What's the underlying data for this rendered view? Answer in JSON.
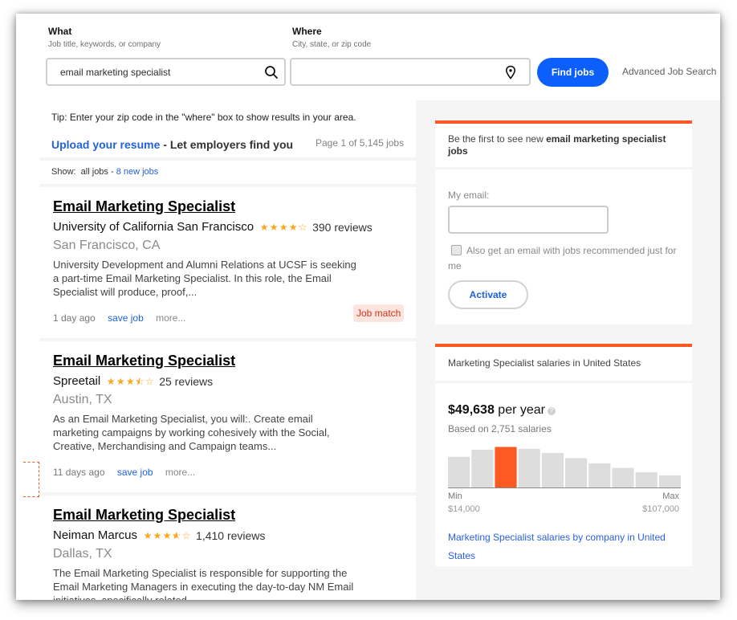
{
  "search": {
    "what_label": "What",
    "what_hint": "Job title, keywords, or company",
    "what_value": "email marketing specialist",
    "where_label": "Where",
    "where_hint": "City, state, or zip code",
    "where_value": "",
    "find_button": "Find jobs",
    "advanced_link": "Advanced Job Search",
    "icons": {
      "what": "search-icon",
      "where": "location-pin-icon"
    }
  },
  "results_header": {
    "tip": "Tip: Enter your zip code in the \"where\" box to show results in your area.",
    "upload_link": "Upload your resume",
    "upload_suffix": " - Let employers find you",
    "page_count": "Page 1 of 5,145 jobs",
    "show_label": "Show:  all jobs - ",
    "new_jobs_link": "8 new jobs"
  },
  "jobs": [
    {
      "title": "Email Marketing Specialist",
      "company": "University of California San Francisco",
      "rating": 4.2,
      "reviews": "390 reviews",
      "location": "San Francisco, CA",
      "snippet": "University Development and Alumni Relations at UCSF is seeking a part-time Email Marketing Specialist. In this role, the Email Specialist will produce, proof,...",
      "posted": "1 day ago",
      "save_label": "save job",
      "more_label": "more...",
      "badge": "Job match"
    },
    {
      "title": "Email Marketing Specialist",
      "company": "Spreetail",
      "rating": 3.5,
      "reviews": "25 reviews",
      "location": "Austin, TX",
      "snippet": "As an Email Marketing Specialist, you will:. Create email marketing campaigns by working cohesively with the Social, Creative, Merchandising and Campaign teams...",
      "posted": "11 days ago",
      "save_label": "save job",
      "more_label": "more...",
      "badge": ""
    },
    {
      "title": "Email Marketing Specialist",
      "company": "Neiman Marcus",
      "rating": 3.6,
      "reviews": "1,410 reviews",
      "location": "Dallas, TX",
      "snippet": "The Email Marketing Specialist is responsible for supporting the Email Marketing Managers in executing the day-to-day NM Email initiatives, specifically related...",
      "posted": "",
      "save_label": "",
      "more_label": "",
      "badge": ""
    }
  ],
  "alert_widget": {
    "heading_prefix": "Be the first to see new ",
    "heading_bold": "email marketing specialist jobs",
    "email_label": "My email:",
    "email_value": "",
    "checkbox_label": "Also get an email with jobs recommended just for me",
    "checkbox_checked": false,
    "activate_button": "Activate"
  },
  "salary_widget": {
    "heading": "Marketing Specialist salaries in United States",
    "amount": "$49,638",
    "period": " per year",
    "based_on": "Based on 2,751 salaries",
    "min_label": "Min",
    "min_value": "$14,000",
    "max_label": "Max",
    "max_value": "$107,000",
    "histogram_relative_heights": [
      0.66,
      0.81,
      0.87,
      0.83,
      0.74,
      0.63,
      0.52,
      0.42,
      0.33,
      0.26
    ],
    "highlight_index": 2,
    "bar_color": "#dddddd",
    "highlight_color": "#fc5a22",
    "link": "Marketing Specialist salaries by company in United States"
  },
  "colors": {
    "accent": "#fc5a22",
    "primary_button": "#0d5ffb",
    "link": "#2163d8",
    "star": "#f9a71b"
  }
}
